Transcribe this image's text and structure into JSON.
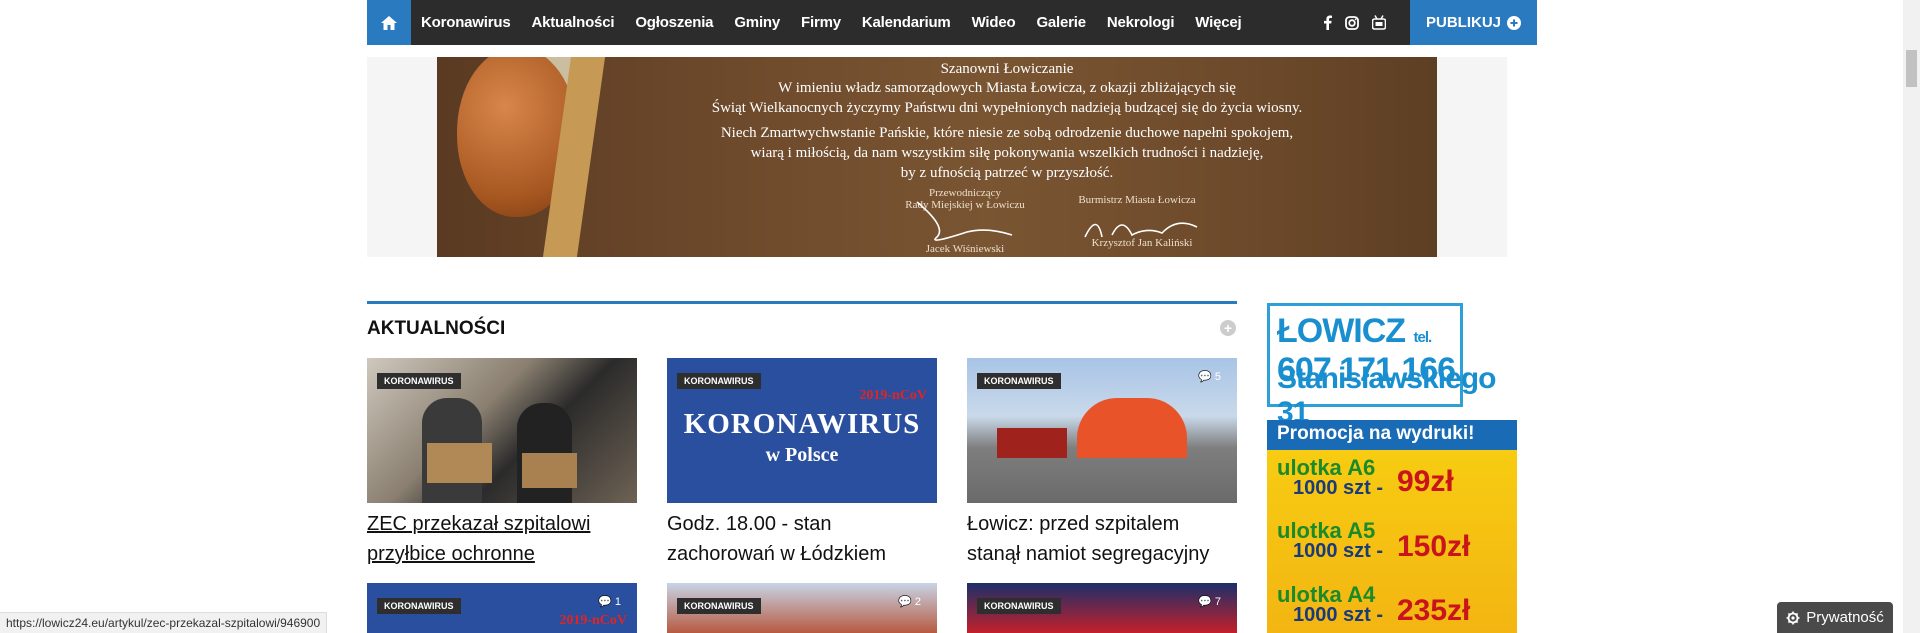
{
  "nav": {
    "items": [
      "Koronawirus",
      "Aktualności",
      "Ogłoszenia",
      "Gminy",
      "Firmy",
      "Kalendarium",
      "Wideo",
      "Galerie",
      "Nekrologi",
      "Więcej"
    ],
    "publish_label": "PUBLIKUJ",
    "social": [
      "facebook-icon",
      "instagram-icon",
      "youtube-icon"
    ]
  },
  "banner": {
    "line1": "Szanowni Łowiczanie",
    "line2": "W imieniu władz samorządowych Miasta Łowicza, z okazji zbliżających się",
    "line3": "Świąt Wielkanocnych życzymy Państwu dni wypełnionych nadzieją budzącej się do życia wiosny.",
    "line4": "Niech Zmartwychwstanie Pańskie, które niesie ze sobą odrodzenie duchowe napełni spokojem,",
    "line5": "wiarą i miłością, da nam wszystkim siłę pokonywania wszelkich trudności i nadzieję,",
    "line6": "by z ufnością patrzeć w przyszłość.",
    "sig1_role1": "Przewodniczący",
    "sig1_role2": "Rady Miejskiej w Łowiczu",
    "sig1_name": "Jacek Wiśniewski",
    "sig2_role": "Burmistrz Miasta Łowicza",
    "sig2_name": "Krzysztof Jan Kaliński"
  },
  "section": {
    "title": "AKTUALNOŚCI"
  },
  "cards": [
    {
      "badge": "KORONAWIRUS",
      "title": "ZEC przekazał szpitalowi przyłbice ochronne",
      "comments": ""
    },
    {
      "badge": "KORONAWIRUS",
      "title": "Godz. 18.00 - stan zachorowań w Łódzkiem",
      "comments": "",
      "overlay1": "2019-nCoV",
      "overlay2": "KORONAWIRUS",
      "overlay3": "w Polsce"
    },
    {
      "badge": "KORONAWIRUS",
      "title": "Łowicz: przed szpitalem stanął namiot segregacyjny",
      "comments": "5"
    }
  ],
  "cards_row2": [
    {
      "badge": "KORONAWIRUS",
      "comments": "1",
      "overlay": "2019-nCoV"
    },
    {
      "badge": "KORONAWIRUS",
      "comments": "2"
    },
    {
      "badge": "KORONAWIRUS",
      "comments": "7"
    }
  ],
  "ad1": {
    "city": "ŁOWICZ",
    "tel_label": "tel.",
    "phone": "607 171 166",
    "address": "Stanisławskiego 31"
  },
  "ad2": {
    "header": "Promocja na wydruki!",
    "rows": [
      {
        "name": "ulotka A6",
        "qty": "1000 szt -",
        "price": "99zł"
      },
      {
        "name": "ulotka A5",
        "qty": "1000 szt -",
        "price": "150zł"
      },
      {
        "name": "ulotka A4",
        "qty": "1000 szt -",
        "price": "235zł"
      }
    ]
  },
  "status_url": "https://lowicz24.eu/artykul/zec-przekazal-szpitalowi/946900",
  "privacy_label": "Prywatność",
  "colors": {
    "accent": "#2a7ac0",
    "nav_bg": "#2c2c2c"
  }
}
